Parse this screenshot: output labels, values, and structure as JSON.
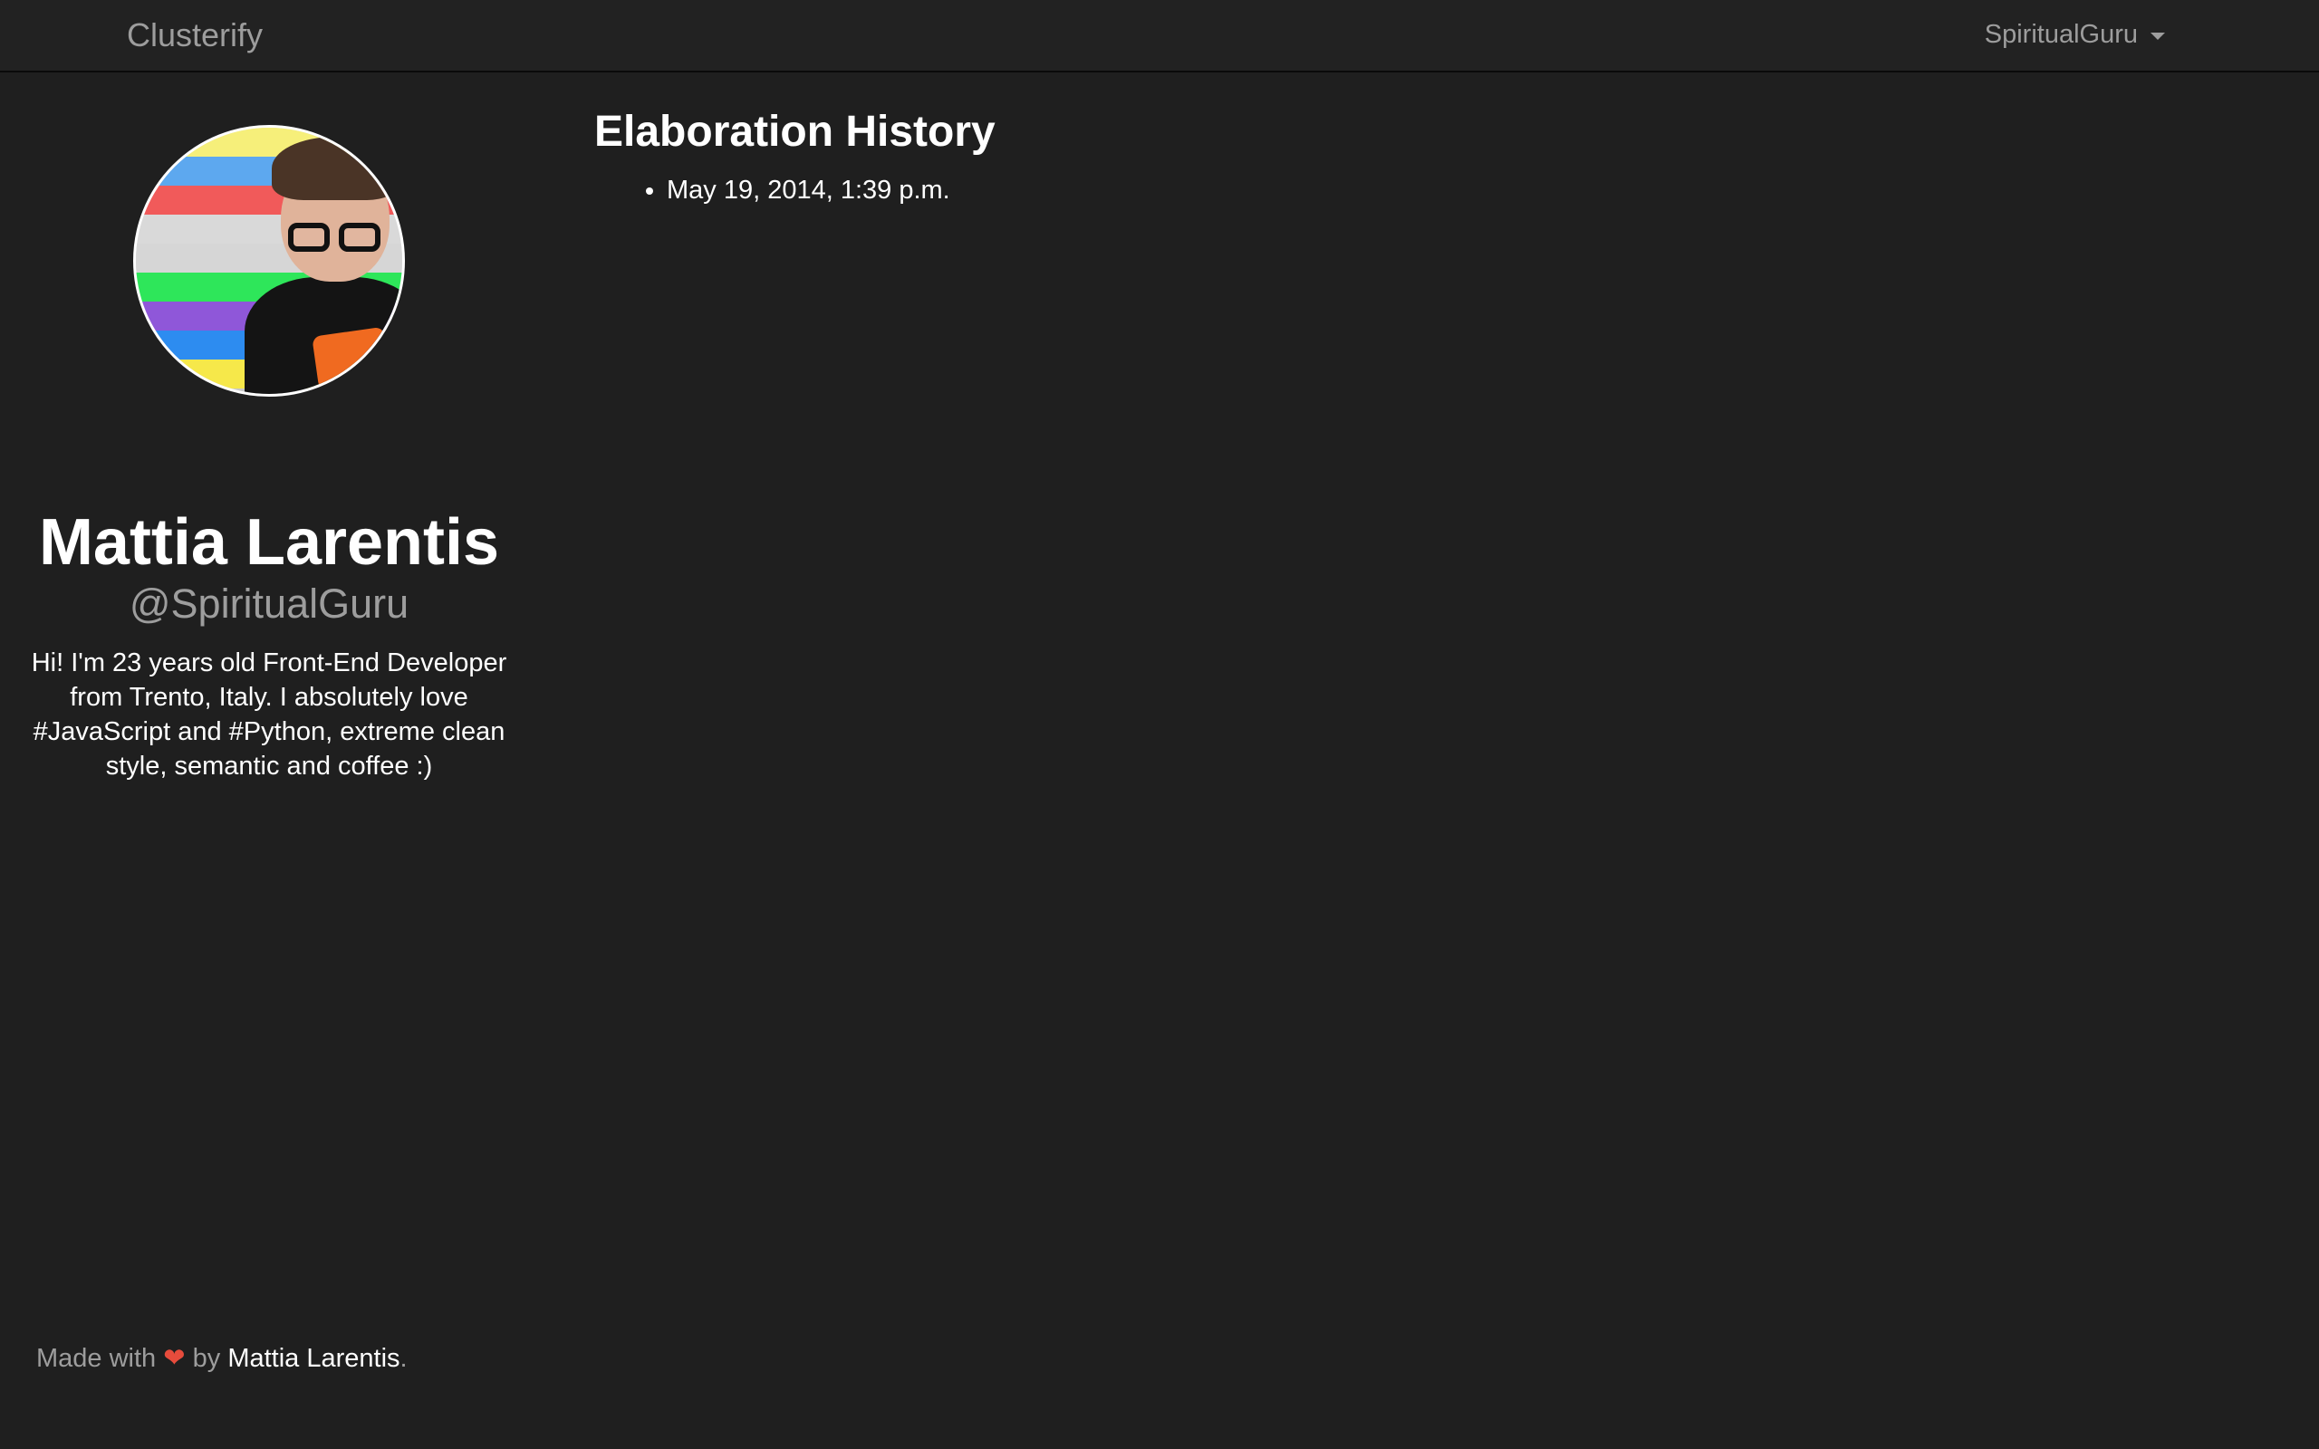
{
  "navbar": {
    "brand": "Clusterify",
    "user_menu_label": "SpiritualGuru"
  },
  "profile": {
    "name": "Mattia Larentis",
    "handle": "@SpiritualGuru",
    "bio": "Hi! I'm 23 years old Front-End Developer from Trento, Italy. I absolutely love #JavaScript and #Python, extreme clean style, semantic and coffee :)"
  },
  "main": {
    "title": "Elaboration History",
    "history": [
      "May 19, 2014, 1:39 p.m."
    ]
  },
  "footer": {
    "made_with": "Made with",
    "heart": "❤",
    "by": "by",
    "author_link": "Mattia Larentis",
    "period": "."
  },
  "colors": {
    "background": "#1f1f1f",
    "navbar": "#222222",
    "muted_text": "#9d9d9d",
    "heart": "#e74c3c"
  },
  "icons": {
    "user_menu_caret": "chevron-down-icon"
  }
}
